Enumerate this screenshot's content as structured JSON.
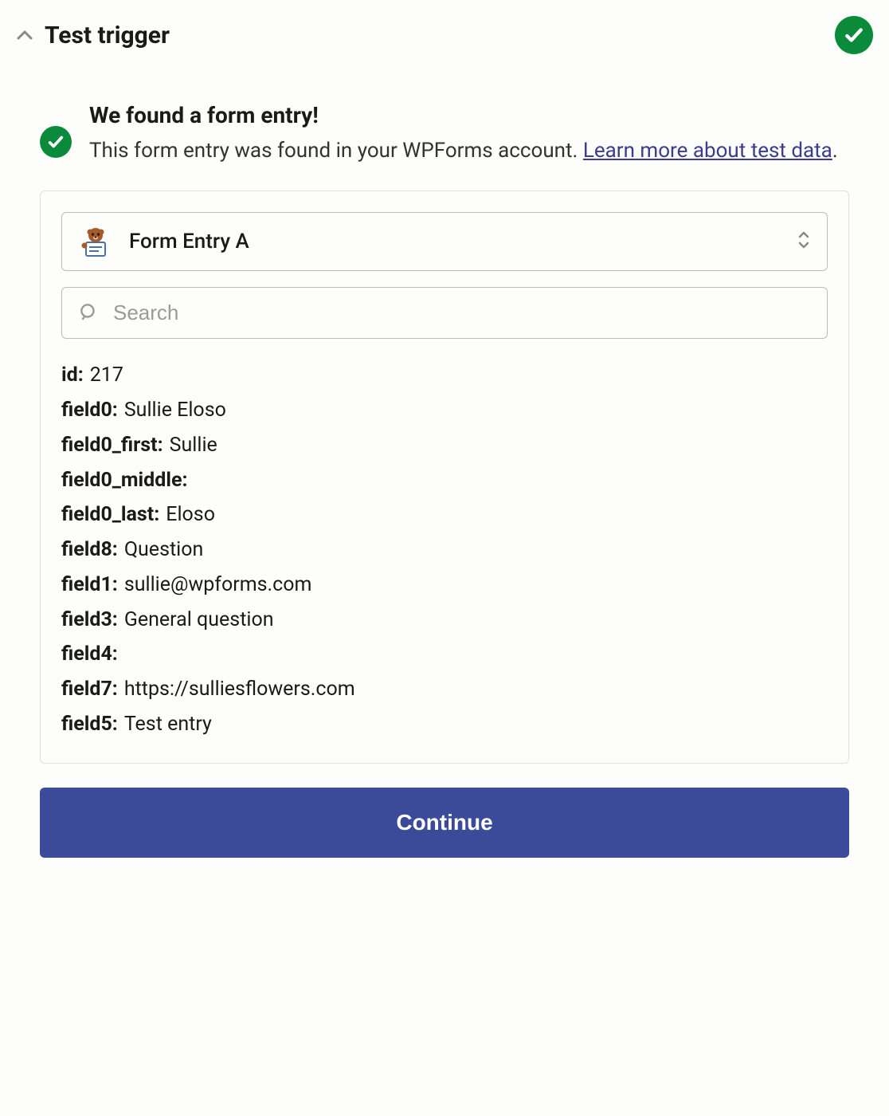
{
  "header": {
    "title": "Test trigger"
  },
  "found": {
    "heading": "We found a form entry!",
    "body_prefix": "This form entry was found in your WPForms account. ",
    "link_text": "Learn more about test data",
    "body_suffix": "."
  },
  "select": {
    "selected_label": "Form Entry A"
  },
  "search": {
    "placeholder": "Search"
  },
  "fields": [
    {
      "key": "id:",
      "value": "217"
    },
    {
      "key": "field0:",
      "value": "Sullie Eloso"
    },
    {
      "key": "field0_first:",
      "value": "Sullie"
    },
    {
      "key": "field0_middle:",
      "value": ""
    },
    {
      "key": "field0_last:",
      "value": "Eloso"
    },
    {
      "key": "field8:",
      "value": "Question"
    },
    {
      "key": "field1:",
      "value": "sullie@wpforms.com"
    },
    {
      "key": "field3:",
      "value": "General question"
    },
    {
      "key": "field4:",
      "value": ""
    },
    {
      "key": "field7:",
      "value": "https://sulliesflowers.com"
    },
    {
      "key": "field5:",
      "value": "Test entry"
    }
  ],
  "continue_label": "Continue"
}
